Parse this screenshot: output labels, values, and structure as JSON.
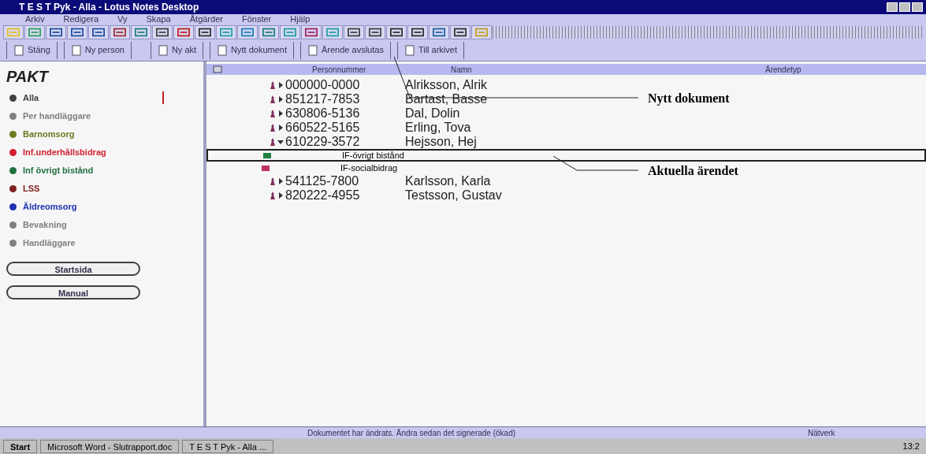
{
  "window": {
    "title": "T E S T Pyk - Alla - Lotus Notes Desktop"
  },
  "menu": [
    "Arkiv",
    "Redigera",
    "Vy",
    "Skapa",
    "Åtgärder",
    "Fönster",
    "Hjälp"
  ],
  "actions": [
    "Stäng",
    "Ny person",
    "Ny akt",
    "Nytt dokument",
    "Ärende avslutas",
    "Till arkivet"
  ],
  "sidebar": {
    "title": "PAKT",
    "items": [
      {
        "label": "Alla",
        "selected": true,
        "color": "#404040"
      },
      {
        "label": "Per handläggare",
        "selected": false,
        "color": "#808080"
      },
      {
        "label": "Barnomsorg",
        "selected": false,
        "color": "#6a7a20"
      },
      {
        "label": "Inf.underhållsbidrag",
        "selected": false,
        "color": "#d02030"
      },
      {
        "label": "Inf övrigt bistånd",
        "selected": false,
        "color": "#207040"
      },
      {
        "label": "LSS",
        "selected": false,
        "color": "#802020"
      },
      {
        "label": "Äldreomsorg",
        "selected": false,
        "color": "#2030b0"
      },
      {
        "label": "Bevakning",
        "selected": false,
        "color": "#808080"
      },
      {
        "label": "Handläggare",
        "selected": false,
        "color": "#808080"
      }
    ],
    "buttons": [
      "Startsida",
      "Manual"
    ]
  },
  "view": {
    "columns": [
      "Personnummer",
      "Namn",
      "Ärendetyp"
    ],
    "rows": [
      {
        "kind": "person",
        "id": "000000-0000",
        "name": "Alriksson, Alrik",
        "expanded": false
      },
      {
        "kind": "person",
        "id": "851217-7853",
        "name": "Bartast, Basse",
        "expanded": false
      },
      {
        "kind": "person",
        "id": "630806-5136",
        "name": "Dal, Dolin",
        "expanded": false
      },
      {
        "kind": "person",
        "id": "660522-5165",
        "name": "Erling, Tova",
        "expanded": false
      },
      {
        "kind": "person",
        "id": "610229-3572",
        "name": "Hejsson, Hej",
        "expanded": true
      },
      {
        "kind": "case",
        "label": "IF-övrigt bistånd",
        "selected": true,
        "color": "#208040"
      },
      {
        "kind": "case",
        "label": "IF-socialbidrag",
        "selected": false,
        "color": "#c03060"
      },
      {
        "kind": "person",
        "id": "541125-7800",
        "name": "Karlsson, Karla",
        "expanded": false
      },
      {
        "kind": "person",
        "id": "820222-4955",
        "name": "Testsson, Gustav",
        "expanded": false
      }
    ]
  },
  "annotations": [
    "Nytt dokument",
    "Aktuella ärendet"
  ],
  "status_bar": {
    "message": "Dokumentet har ändrats. Ändra sedan det signerade (ökad)",
    "location": "Nätverk"
  },
  "taskbar": {
    "start": "Start",
    "tasks": [
      "Microsoft Word - Slutrapport.doc",
      "T E S T Pyk - Alla ..."
    ],
    "clock": "13:2"
  }
}
